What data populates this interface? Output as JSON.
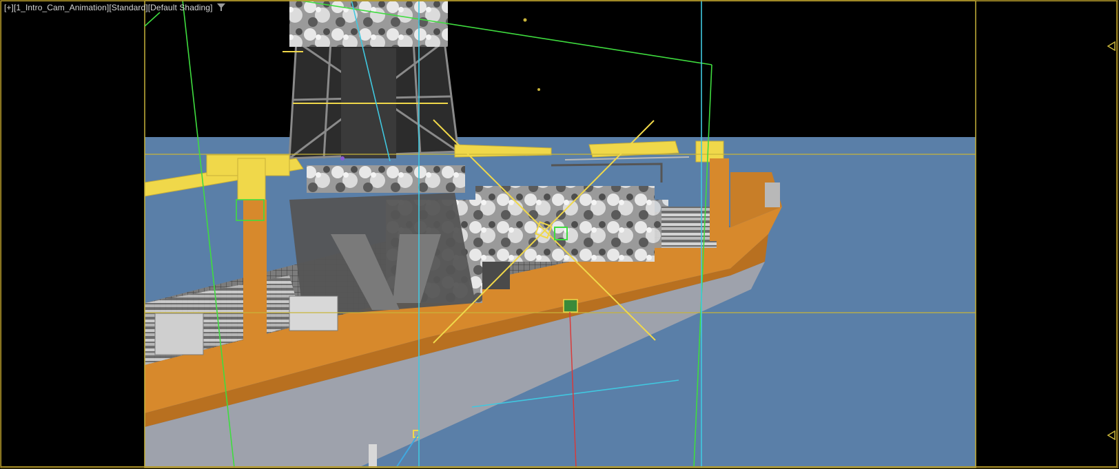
{
  "viewport": {
    "label": {
      "menu": "[+]",
      "camera": "[1_Intro_Cam_Animation]",
      "mode": "[Standard]",
      "shading": "[Default Shading]"
    },
    "filter_icon": "funnel-filter-icon",
    "range_marker_icon": "triangle-marker-icon",
    "colors": {
      "background": "#000000",
      "sea": "#5a7fa8",
      "hull_orange": "#d7892c",
      "hull_gray": "#9ea2ac",
      "safe_frame": "#c8b43a",
      "frustum": "#3fdc3f",
      "ortho_line": "#40c8e0",
      "crane_yellow": "#f0d84a",
      "steel": "#6a6a6a"
    }
  }
}
